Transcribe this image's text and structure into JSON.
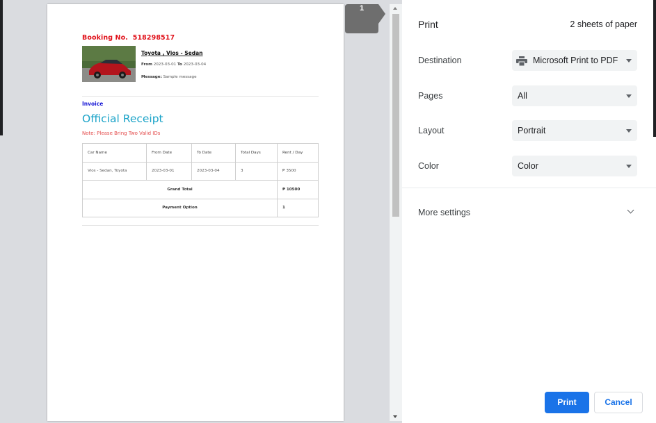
{
  "dialog": {
    "title": "Print",
    "sheets": "2 sheets of paper",
    "page_badge": "1"
  },
  "settings": {
    "destination": {
      "label": "Destination",
      "value": "Microsoft Print to PDF"
    },
    "pages": {
      "label": "Pages",
      "value": "All"
    },
    "layout": {
      "label": "Layout",
      "value": "Portrait"
    },
    "color": {
      "label": "Color",
      "value": "Color"
    },
    "more_settings": "More settings"
  },
  "buttons": {
    "print": "Print",
    "cancel": "Cancel"
  },
  "document": {
    "booking_label": "Booking No.",
    "booking_number": "518298517",
    "car_name": "Toyota , Vios - Sedan",
    "from_label": "From",
    "from_date": "2023-03-01",
    "to_label": "To",
    "to_date": "2023-03-04",
    "message_label": "Message:",
    "message": "Sample message",
    "invoice_label": "Invoice",
    "receipt_title": "Official Receipt",
    "note": "Note: Please Bring Two Valid IDs",
    "table": {
      "headers": [
        "Car Name",
        "From Date",
        "To Date",
        "Total Days",
        "Rent / Day"
      ],
      "row": [
        "Vios - Sedan, Toyota",
        "2023-03-01",
        "2023-03-04",
        "3",
        "₱ 3500"
      ],
      "grand_total_label": "Grand Total",
      "grand_total_value": "₱ 10500",
      "payment_label": "Payment Option",
      "payment_value": "1"
    }
  },
  "colors": {
    "accent": "#1a73e8",
    "booking_red": "#e0121b",
    "invoice_blue": "#1a1ad6",
    "receipt_teal": "#1aa3c8"
  }
}
